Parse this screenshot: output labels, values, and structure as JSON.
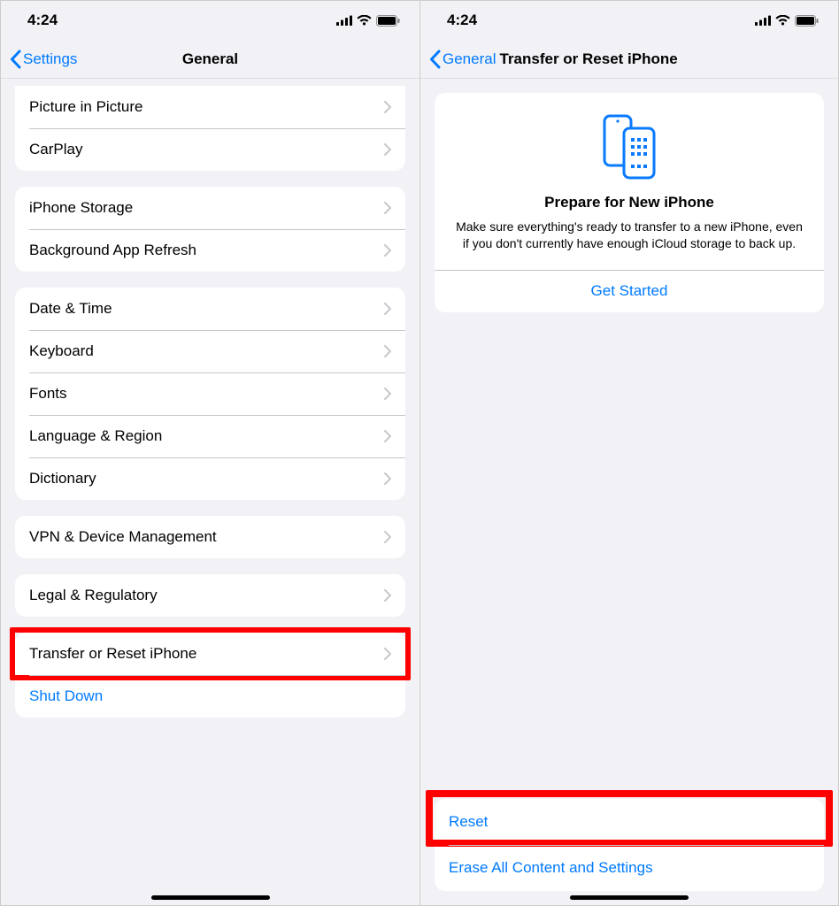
{
  "status": {
    "time": "4:24"
  },
  "left": {
    "back_label": "Settings",
    "title": "General",
    "group1": [
      {
        "label": "Picture in Picture"
      },
      {
        "label": "CarPlay"
      }
    ],
    "group2": [
      {
        "label": "iPhone Storage"
      },
      {
        "label": "Background App Refresh"
      }
    ],
    "group3": [
      {
        "label": "Date & Time"
      },
      {
        "label": "Keyboard"
      },
      {
        "label": "Fonts"
      },
      {
        "label": "Language & Region"
      },
      {
        "label": "Dictionary"
      }
    ],
    "group4": [
      {
        "label": "VPN & Device Management"
      }
    ],
    "group5": [
      {
        "label": "Legal & Regulatory"
      }
    ],
    "group6": {
      "transfer": "Transfer or Reset iPhone",
      "shutdown": "Shut Down"
    }
  },
  "right": {
    "back_label": "General",
    "title": "Transfer or Reset iPhone",
    "card": {
      "heading": "Prepare for New iPhone",
      "body": "Make sure everything's ready to transfer to a new iPhone, even if you don't currently have enough iCloud storage to back up.",
      "cta": "Get Started"
    },
    "bottom": {
      "reset": "Reset",
      "erase": "Erase All Content and Settings"
    }
  }
}
